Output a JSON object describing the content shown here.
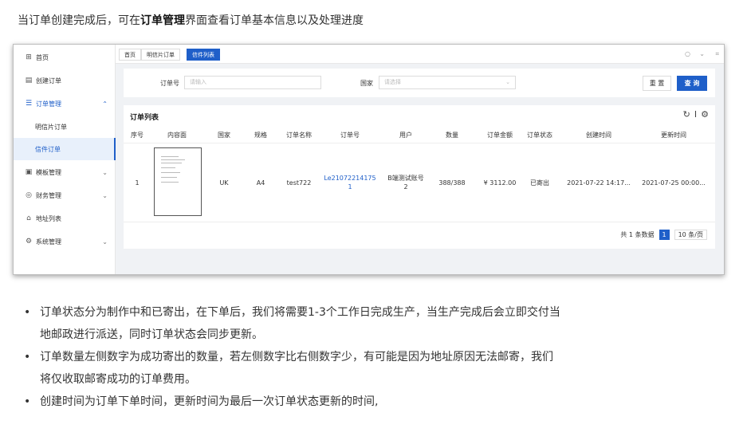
{
  "intro": {
    "prefix": "当订单创建完成后，可在",
    "bold": "订单管理",
    "suffix": "界面查看订单基本信息以及处理进度"
  },
  "sidebar": {
    "items": [
      {
        "label": "首页",
        "icon": "grid-icon"
      },
      {
        "label": "创建订单",
        "icon": "calendar-icon"
      },
      {
        "label": "订单管理",
        "icon": "list-icon"
      },
      {
        "label": "明信片订单",
        "icon": ""
      },
      {
        "label": "信件订单",
        "icon": ""
      },
      {
        "label": "模板管理",
        "icon": "image-icon"
      },
      {
        "label": "财务管理",
        "icon": "coin-icon"
      },
      {
        "label": "地址列表",
        "icon": "home-icon"
      },
      {
        "label": "系统管理",
        "icon": "gear-icon"
      }
    ]
  },
  "tabs": [
    "首页",
    "明信片订单",
    "信件列表"
  ],
  "search": {
    "order_label": "订单号",
    "order_placeholder": "请输入",
    "country_label": "国家",
    "country_placeholder": "请选择",
    "reset": "重 置",
    "query": "查 询"
  },
  "table": {
    "title": "订单列表",
    "columns": [
      "序号",
      "内容面",
      "国家",
      "规格",
      "订单名称",
      "订单号",
      "用户",
      "数量",
      "订单金额",
      "订单状态",
      "创建时间",
      "更新时间"
    ],
    "rows": [
      {
        "index": "1",
        "country": "UK",
        "spec": "A4",
        "name": "test722",
        "order_no_1": "Le21072214175",
        "order_no_2": "1",
        "user_1": "B端测试账号",
        "user_2": "2",
        "qty": "388/388",
        "amount": "¥ 3112.00",
        "status": "已寄出",
        "created": "2021-07-22 14:17...",
        "updated": "2021-07-25 00:00..."
      }
    ]
  },
  "pager": {
    "total": "共 1 条数据",
    "page": "1",
    "size": "10 条/页"
  },
  "bullets": [
    "订单状态分为制作中和已寄出，在下单后，我们将需要1-3个工作日完成生产，当生产完成后会立即交付当",
    "地邮政进行派送，同时订单状态会同步更新。",
    "订单数量左侧数字为成功寄出的数量，若左侧数字比右侧数字少，有可能是因为地址原因无法邮寄，我们",
    "将仅收取邮寄成功的订单费用。",
    "创建时间为订单下单时间，更新时间为最后一次订单状态更新的时间,"
  ],
  "colors": {
    "accent": "#1f5fc9",
    "bg": "#f0f2f5"
  }
}
